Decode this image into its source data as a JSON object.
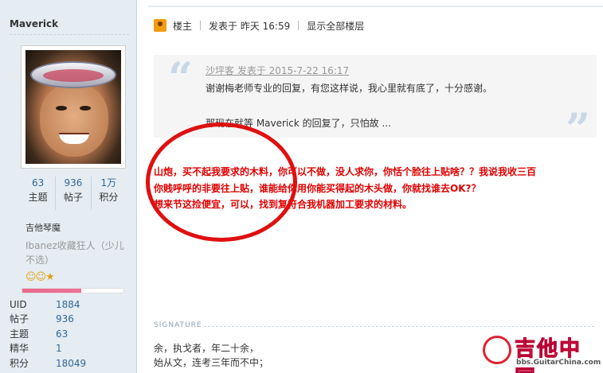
{
  "user": {
    "name": "Maverick",
    "stats": [
      {
        "value": "63",
        "label": "主题"
      },
      {
        "value": "936",
        "label": "帖子"
      },
      {
        "value": "1万",
        "label": "积分"
      }
    ],
    "group": "吉他琴魔",
    "title": "Ibanez收藏狂人（少儿不选）",
    "medals": "☺☺★",
    "progress": 0.58,
    "info": [
      {
        "key": "UID",
        "value": "1884"
      },
      {
        "key": "帖子",
        "value": "936"
      },
      {
        "key": "主题",
        "value": "63"
      },
      {
        "key": "精华",
        "value": "1"
      },
      {
        "key": "积分",
        "value": "18049"
      }
    ]
  },
  "post": {
    "floor": "楼主",
    "posted": "发表于 昨天 16:59",
    "show_all": "显示全部楼层",
    "quote": {
      "author": "沙坪客 发表于 2015-7-22 16:17",
      "line1": "谢谢梅老师专业的回复，有您这样说，我心里就有底了，十分感谢。",
      "line2": "那现在就等 Maverick 的回复了，只怕故 ..."
    },
    "reply": [
      "山炮，买不起我要求的木料，你可以不做，没人求你，你恬个脸往上贴啥？？我说我收三百",
      "你贱呼呼的非要往上贴，谁能给你用你能买得起的木头做，你就找谁去OK?？",
      "想来节这捡便宜，可以，找到复符合我机器加工要求的材料。"
    ]
  },
  "signature": {
    "label": "SIGNATURE",
    "line1": "余，执戈者，年二十余，",
    "line2": "始从文，连考三年而不中；"
  },
  "watermark": {
    "cn": "吉他中国",
    "url": "bbs.GuitarChina.com"
  },
  "colors": {
    "accent": "#336699",
    "highlight": "#e00000",
    "sidebar": "#e5edf2"
  }
}
